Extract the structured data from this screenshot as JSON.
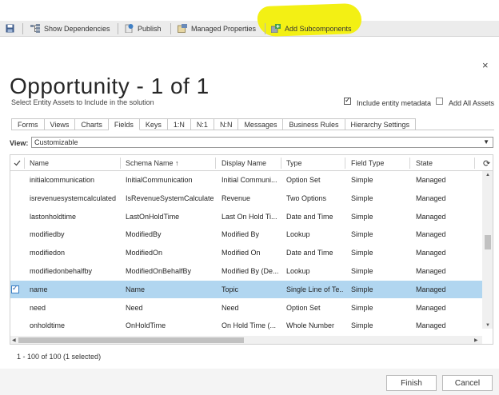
{
  "toolbar": {
    "show_dependencies": "Show Dependencies",
    "publish": "Publish",
    "managed_properties": "Managed Properties",
    "add_subcomponents": "Add Subcomponents"
  },
  "dialog": {
    "close": "×",
    "title": "Opportunity - 1 of 1",
    "subtitle": "Select Entity Assets to Include in the solution",
    "include_metadata": "Include entity metadata",
    "add_all_assets": "Add All Assets"
  },
  "tabs": [
    "Forms",
    "Views",
    "Charts",
    "Fields",
    "Keys",
    "1:N",
    "N:1",
    "N:N",
    "Messages",
    "Business Rules",
    "Hierarchy Settings"
  ],
  "active_tab": "Fields",
  "view": {
    "label": "View:",
    "selected": "Customizable",
    "caret": "▼"
  },
  "grid": {
    "headers": [
      "Name",
      "Schema Name ↑",
      "Display Name",
      "Type",
      "Field Type",
      "State"
    ],
    "refresh_icon": "⟳",
    "rows": [
      [
        "initialcommunication",
        "InitialCommunication",
        "Initial Communi...",
        "Option Set",
        "Simple",
        "Managed"
      ],
      [
        "isrevenuesystemcalculated",
        "IsRevenueSystemCalculated",
        "Revenue",
        "Two Options",
        "Simple",
        "Managed"
      ],
      [
        "lastonholdtime",
        "LastOnHoldTime",
        "Last On Hold Ti...",
        "Date and Time",
        "Simple",
        "Managed"
      ],
      [
        "modifiedby",
        "ModifiedBy",
        "Modified By",
        "Lookup",
        "Simple",
        "Managed"
      ],
      [
        "modifiedon",
        "ModifiedOn",
        "Modified On",
        "Date and Time",
        "Simple",
        "Managed"
      ],
      [
        "modifiedonbehalfby",
        "ModifiedOnBehalfBy",
        "Modified By (De...",
        "Lookup",
        "Simple",
        "Managed"
      ],
      [
        "name",
        "Name",
        "Topic",
        "Single Line of Te...",
        "Simple",
        "Managed"
      ],
      [
        "need",
        "Need",
        "Need",
        "Option Set",
        "Simple",
        "Managed"
      ],
      [
        "onholdtime",
        "OnHoldTime",
        "On Hold Time (...",
        "Whole Number",
        "Simple",
        "Managed"
      ]
    ],
    "selected_row": 6
  },
  "status": "1 - 100 of 100 (1 selected)",
  "buttons": {
    "finish": "Finish",
    "cancel": "Cancel"
  },
  "colors": {
    "selection": "#b1d6f0",
    "highlight": "#f3f014"
  }
}
